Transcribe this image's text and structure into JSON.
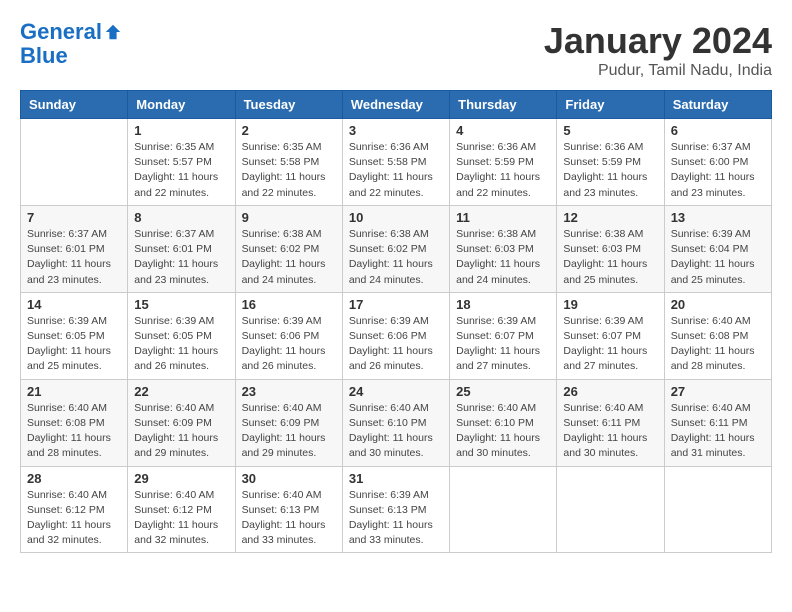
{
  "header": {
    "logo_line1": "General",
    "logo_line2": "Blue",
    "title": "January 2024",
    "subtitle": "Pudur, Tamil Nadu, India"
  },
  "weekdays": [
    "Sunday",
    "Monday",
    "Tuesday",
    "Wednesday",
    "Thursday",
    "Friday",
    "Saturday"
  ],
  "weeks": [
    [
      {
        "day": "",
        "info": ""
      },
      {
        "day": "1",
        "info": "Sunrise: 6:35 AM\nSunset: 5:57 PM\nDaylight: 11 hours\nand 22 minutes."
      },
      {
        "day": "2",
        "info": "Sunrise: 6:35 AM\nSunset: 5:58 PM\nDaylight: 11 hours\nand 22 minutes."
      },
      {
        "day": "3",
        "info": "Sunrise: 6:36 AM\nSunset: 5:58 PM\nDaylight: 11 hours\nand 22 minutes."
      },
      {
        "day": "4",
        "info": "Sunrise: 6:36 AM\nSunset: 5:59 PM\nDaylight: 11 hours\nand 22 minutes."
      },
      {
        "day": "5",
        "info": "Sunrise: 6:36 AM\nSunset: 5:59 PM\nDaylight: 11 hours\nand 23 minutes."
      },
      {
        "day": "6",
        "info": "Sunrise: 6:37 AM\nSunset: 6:00 PM\nDaylight: 11 hours\nand 23 minutes."
      }
    ],
    [
      {
        "day": "7",
        "info": "Sunrise: 6:37 AM\nSunset: 6:01 PM\nDaylight: 11 hours\nand 23 minutes."
      },
      {
        "day": "8",
        "info": "Sunrise: 6:37 AM\nSunset: 6:01 PM\nDaylight: 11 hours\nand 23 minutes."
      },
      {
        "day": "9",
        "info": "Sunrise: 6:38 AM\nSunset: 6:02 PM\nDaylight: 11 hours\nand 24 minutes."
      },
      {
        "day": "10",
        "info": "Sunrise: 6:38 AM\nSunset: 6:02 PM\nDaylight: 11 hours\nand 24 minutes."
      },
      {
        "day": "11",
        "info": "Sunrise: 6:38 AM\nSunset: 6:03 PM\nDaylight: 11 hours\nand 24 minutes."
      },
      {
        "day": "12",
        "info": "Sunrise: 6:38 AM\nSunset: 6:03 PM\nDaylight: 11 hours\nand 25 minutes."
      },
      {
        "day": "13",
        "info": "Sunrise: 6:39 AM\nSunset: 6:04 PM\nDaylight: 11 hours\nand 25 minutes."
      }
    ],
    [
      {
        "day": "14",
        "info": "Sunrise: 6:39 AM\nSunset: 6:05 PM\nDaylight: 11 hours\nand 25 minutes."
      },
      {
        "day": "15",
        "info": "Sunrise: 6:39 AM\nSunset: 6:05 PM\nDaylight: 11 hours\nand 26 minutes."
      },
      {
        "day": "16",
        "info": "Sunrise: 6:39 AM\nSunset: 6:06 PM\nDaylight: 11 hours\nand 26 minutes."
      },
      {
        "day": "17",
        "info": "Sunrise: 6:39 AM\nSunset: 6:06 PM\nDaylight: 11 hours\nand 26 minutes."
      },
      {
        "day": "18",
        "info": "Sunrise: 6:39 AM\nSunset: 6:07 PM\nDaylight: 11 hours\nand 27 minutes."
      },
      {
        "day": "19",
        "info": "Sunrise: 6:39 AM\nSunset: 6:07 PM\nDaylight: 11 hours\nand 27 minutes."
      },
      {
        "day": "20",
        "info": "Sunrise: 6:40 AM\nSunset: 6:08 PM\nDaylight: 11 hours\nand 28 minutes."
      }
    ],
    [
      {
        "day": "21",
        "info": "Sunrise: 6:40 AM\nSunset: 6:08 PM\nDaylight: 11 hours\nand 28 minutes."
      },
      {
        "day": "22",
        "info": "Sunrise: 6:40 AM\nSunset: 6:09 PM\nDaylight: 11 hours\nand 29 minutes."
      },
      {
        "day": "23",
        "info": "Sunrise: 6:40 AM\nSunset: 6:09 PM\nDaylight: 11 hours\nand 29 minutes."
      },
      {
        "day": "24",
        "info": "Sunrise: 6:40 AM\nSunset: 6:10 PM\nDaylight: 11 hours\nand 30 minutes."
      },
      {
        "day": "25",
        "info": "Sunrise: 6:40 AM\nSunset: 6:10 PM\nDaylight: 11 hours\nand 30 minutes."
      },
      {
        "day": "26",
        "info": "Sunrise: 6:40 AM\nSunset: 6:11 PM\nDaylight: 11 hours\nand 30 minutes."
      },
      {
        "day": "27",
        "info": "Sunrise: 6:40 AM\nSunset: 6:11 PM\nDaylight: 11 hours\nand 31 minutes."
      }
    ],
    [
      {
        "day": "28",
        "info": "Sunrise: 6:40 AM\nSunset: 6:12 PM\nDaylight: 11 hours\nand 32 minutes."
      },
      {
        "day": "29",
        "info": "Sunrise: 6:40 AM\nSunset: 6:12 PM\nDaylight: 11 hours\nand 32 minutes."
      },
      {
        "day": "30",
        "info": "Sunrise: 6:40 AM\nSunset: 6:13 PM\nDaylight: 11 hours\nand 33 minutes."
      },
      {
        "day": "31",
        "info": "Sunrise: 6:39 AM\nSunset: 6:13 PM\nDaylight: 11 hours\nand 33 minutes."
      },
      {
        "day": "",
        "info": ""
      },
      {
        "day": "",
        "info": ""
      },
      {
        "day": "",
        "info": ""
      }
    ]
  ]
}
